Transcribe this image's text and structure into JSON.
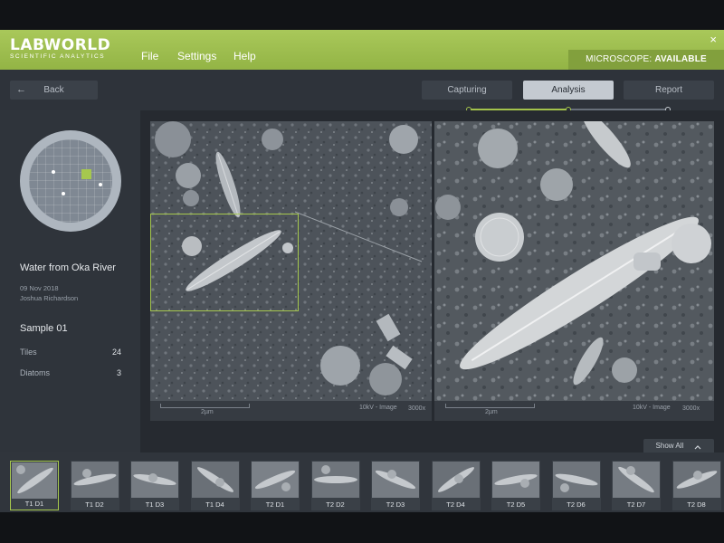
{
  "header": {
    "logo": "LABWORLD",
    "logo_sub": "SCIENTIFIC ANALYTICS",
    "menu": [
      "File",
      "Settings",
      "Help"
    ],
    "close": "×",
    "status_label": "MICROSCOPE:",
    "status_value": "AVAILABLE"
  },
  "toolbar": {
    "back_label": "Back",
    "back_icon": "←",
    "tabs": [
      "Capturing",
      "Analysis",
      "Report"
    ],
    "active_tab": "Analysis",
    "step_count": 3
  },
  "sidebar": {
    "title": "Water from Oka River",
    "date": "09 Nov 2018",
    "author": "Joshua Richardson",
    "sample": "Sample 01",
    "rows": [
      {
        "label": "Tiles",
        "value": "24"
      },
      {
        "label": "Diatoms",
        "value": "3"
      }
    ]
  },
  "viewer": {
    "left": {
      "scale": "2µm",
      "kv": "10kV - Image",
      "zoom": "3000x"
    },
    "right": {
      "scale": "2µm",
      "kv": "10kV - Image",
      "zoom": "3000x"
    }
  },
  "thumbnails": {
    "show_all": "Show All",
    "show_all_icon": "chevron-up-icon",
    "items": [
      "T1 D1",
      "T1 D2",
      "T1 D3",
      "T1 D4",
      "T2 D1",
      "T2 D2",
      "T2 D3",
      "T2 D4",
      "T2 D5",
      "T2 D6",
      "T2 D7",
      "T2 D8"
    ],
    "selected": "T1 D1"
  },
  "colors": {
    "accent": "#a6c84e",
    "header": "#9dbe4f",
    "panel": "#2b3037"
  }
}
